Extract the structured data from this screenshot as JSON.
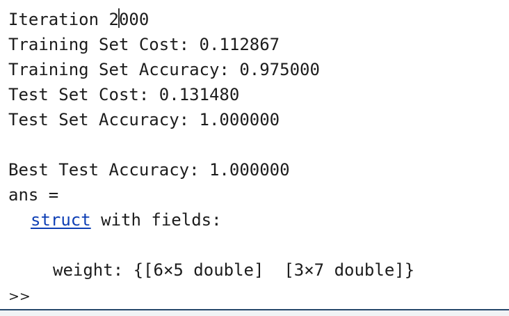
{
  "console": {
    "iteration_prefix": "Iteration 2",
    "iteration_suffix": "000",
    "training_cost": "Training Set Cost: 0.112867",
    "training_accuracy": "Training Set Accuracy: 0.975000",
    "test_cost": "Test Set Cost: 0.131480",
    "test_accuracy": "Test Set Accuracy: 1.000000",
    "best_test_accuracy": "Best Test Accuracy: 1.000000",
    "ans_label": "ans =",
    "struct_link": "struct",
    "struct_suffix": " with fields:",
    "weight_field": "weight: {[6×5 double]  [3×7 double]}",
    "prompt": ">>"
  },
  "colors": {
    "text": "#1c1c1c",
    "link": "#0e3fb5",
    "bottom_border": "#26476b"
  }
}
